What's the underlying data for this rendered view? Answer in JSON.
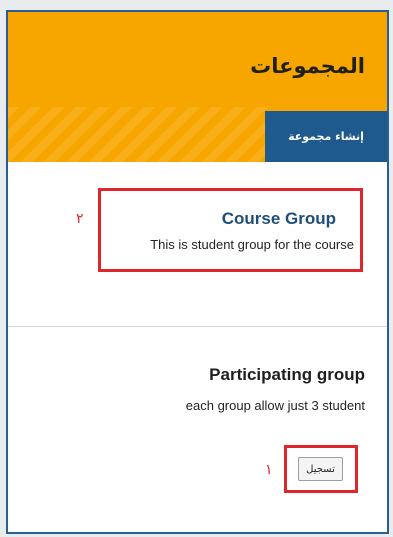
{
  "header": {
    "title": "المجموعات",
    "create_button_label": "إنشاء مجموعة"
  },
  "course_group": {
    "title": "Course Group",
    "description": "This is student group for the course",
    "marker": "٢"
  },
  "participating_group": {
    "title": "Participating group",
    "description": "each group allow just 3 student",
    "register_button_label": "تسجيل",
    "marker": "١"
  },
  "colors": {
    "header_bg": "#f7a600",
    "create_button_bg": "#1e5a8e",
    "highlight_box": "#e0262d",
    "group_title": "#1f4e79",
    "frame_border": "#2b5f93"
  }
}
